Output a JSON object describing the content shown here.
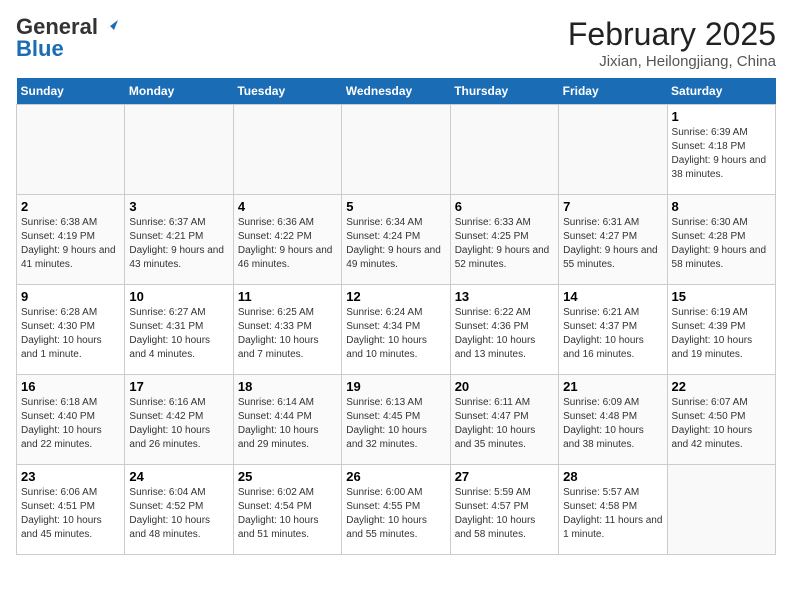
{
  "header": {
    "logo_general": "General",
    "logo_blue": "Blue",
    "month_year": "February 2025",
    "location": "Jixian, Heilongjiang, China"
  },
  "days_of_week": [
    "Sunday",
    "Monday",
    "Tuesday",
    "Wednesday",
    "Thursday",
    "Friday",
    "Saturday"
  ],
  "weeks": [
    [
      {
        "day": "",
        "info": ""
      },
      {
        "day": "",
        "info": ""
      },
      {
        "day": "",
        "info": ""
      },
      {
        "day": "",
        "info": ""
      },
      {
        "day": "",
        "info": ""
      },
      {
        "day": "",
        "info": ""
      },
      {
        "day": "1",
        "info": "Sunrise: 6:39 AM\nSunset: 4:18 PM\nDaylight: 9 hours and 38 minutes."
      }
    ],
    [
      {
        "day": "2",
        "info": "Sunrise: 6:38 AM\nSunset: 4:19 PM\nDaylight: 9 hours and 41 minutes."
      },
      {
        "day": "3",
        "info": "Sunrise: 6:37 AM\nSunset: 4:21 PM\nDaylight: 9 hours and 43 minutes."
      },
      {
        "day": "4",
        "info": "Sunrise: 6:36 AM\nSunset: 4:22 PM\nDaylight: 9 hours and 46 minutes."
      },
      {
        "day": "5",
        "info": "Sunrise: 6:34 AM\nSunset: 4:24 PM\nDaylight: 9 hours and 49 minutes."
      },
      {
        "day": "6",
        "info": "Sunrise: 6:33 AM\nSunset: 4:25 PM\nDaylight: 9 hours and 52 minutes."
      },
      {
        "day": "7",
        "info": "Sunrise: 6:31 AM\nSunset: 4:27 PM\nDaylight: 9 hours and 55 minutes."
      },
      {
        "day": "8",
        "info": "Sunrise: 6:30 AM\nSunset: 4:28 PM\nDaylight: 9 hours and 58 minutes."
      }
    ],
    [
      {
        "day": "9",
        "info": "Sunrise: 6:28 AM\nSunset: 4:30 PM\nDaylight: 10 hours and 1 minute."
      },
      {
        "day": "10",
        "info": "Sunrise: 6:27 AM\nSunset: 4:31 PM\nDaylight: 10 hours and 4 minutes."
      },
      {
        "day": "11",
        "info": "Sunrise: 6:25 AM\nSunset: 4:33 PM\nDaylight: 10 hours and 7 minutes."
      },
      {
        "day": "12",
        "info": "Sunrise: 6:24 AM\nSunset: 4:34 PM\nDaylight: 10 hours and 10 minutes."
      },
      {
        "day": "13",
        "info": "Sunrise: 6:22 AM\nSunset: 4:36 PM\nDaylight: 10 hours and 13 minutes."
      },
      {
        "day": "14",
        "info": "Sunrise: 6:21 AM\nSunset: 4:37 PM\nDaylight: 10 hours and 16 minutes."
      },
      {
        "day": "15",
        "info": "Sunrise: 6:19 AM\nSunset: 4:39 PM\nDaylight: 10 hours and 19 minutes."
      }
    ],
    [
      {
        "day": "16",
        "info": "Sunrise: 6:18 AM\nSunset: 4:40 PM\nDaylight: 10 hours and 22 minutes."
      },
      {
        "day": "17",
        "info": "Sunrise: 6:16 AM\nSunset: 4:42 PM\nDaylight: 10 hours and 26 minutes."
      },
      {
        "day": "18",
        "info": "Sunrise: 6:14 AM\nSunset: 4:44 PM\nDaylight: 10 hours and 29 minutes."
      },
      {
        "day": "19",
        "info": "Sunrise: 6:13 AM\nSunset: 4:45 PM\nDaylight: 10 hours and 32 minutes."
      },
      {
        "day": "20",
        "info": "Sunrise: 6:11 AM\nSunset: 4:47 PM\nDaylight: 10 hours and 35 minutes."
      },
      {
        "day": "21",
        "info": "Sunrise: 6:09 AM\nSunset: 4:48 PM\nDaylight: 10 hours and 38 minutes."
      },
      {
        "day": "22",
        "info": "Sunrise: 6:07 AM\nSunset: 4:50 PM\nDaylight: 10 hours and 42 minutes."
      }
    ],
    [
      {
        "day": "23",
        "info": "Sunrise: 6:06 AM\nSunset: 4:51 PM\nDaylight: 10 hours and 45 minutes."
      },
      {
        "day": "24",
        "info": "Sunrise: 6:04 AM\nSunset: 4:52 PM\nDaylight: 10 hours and 48 minutes."
      },
      {
        "day": "25",
        "info": "Sunrise: 6:02 AM\nSunset: 4:54 PM\nDaylight: 10 hours and 51 minutes."
      },
      {
        "day": "26",
        "info": "Sunrise: 6:00 AM\nSunset: 4:55 PM\nDaylight: 10 hours and 55 minutes."
      },
      {
        "day": "27",
        "info": "Sunrise: 5:59 AM\nSunset: 4:57 PM\nDaylight: 10 hours and 58 minutes."
      },
      {
        "day": "28",
        "info": "Sunrise: 5:57 AM\nSunset: 4:58 PM\nDaylight: 11 hours and 1 minute."
      },
      {
        "day": "",
        "info": ""
      }
    ]
  ]
}
